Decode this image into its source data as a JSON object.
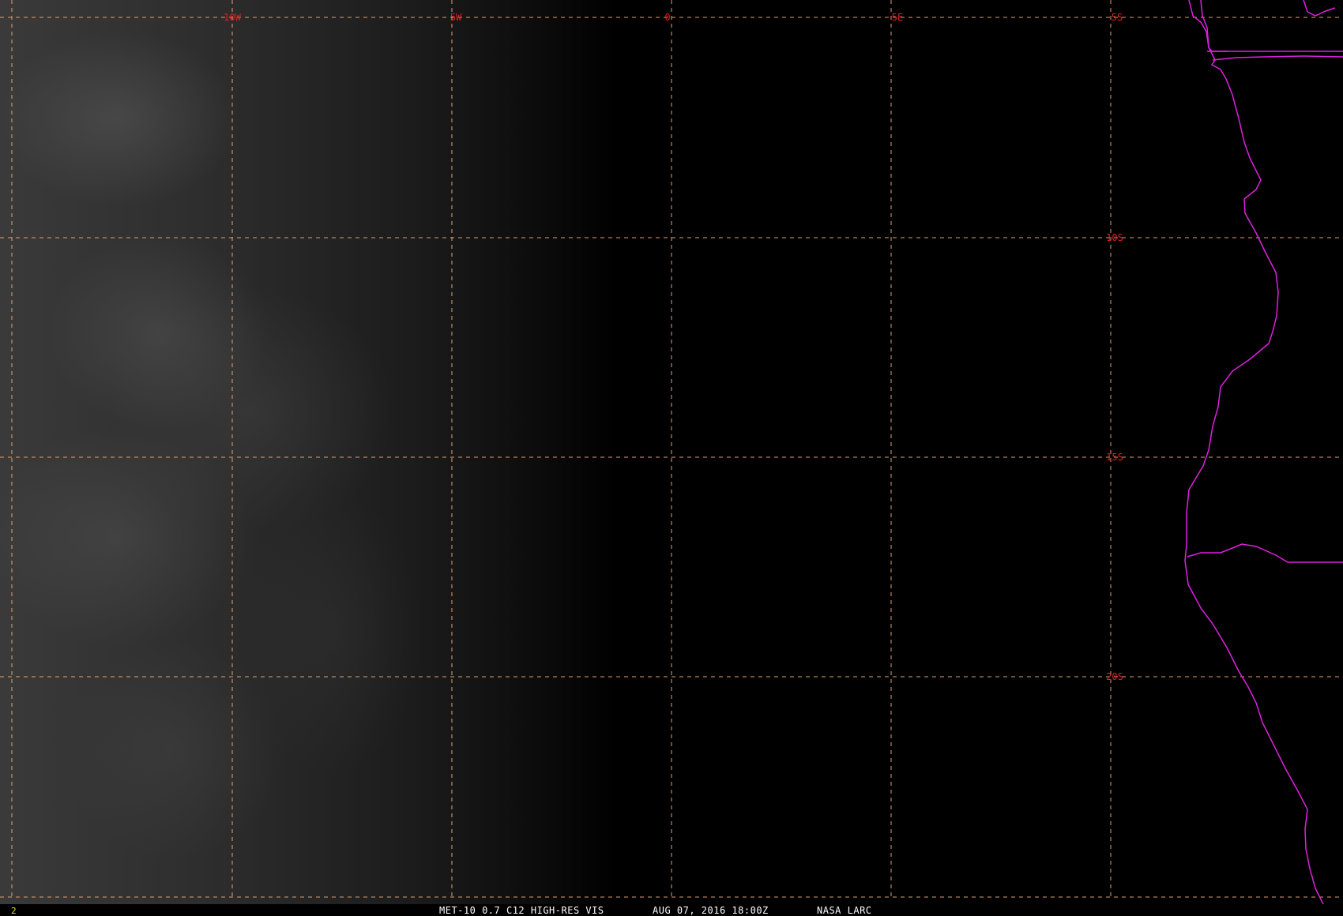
{
  "map": {
    "longitude_labels": [
      "10W",
      "5W",
      "0",
      "5E"
    ],
    "latitude_labels": [
      "5S",
      "10S",
      "15S",
      "20S"
    ],
    "colors": {
      "grid": "#e0a070",
      "grid_labels": "#e02020",
      "coastline": "#e020e0",
      "frame_number": "#e0e020",
      "caption": "#ffffff"
    }
  },
  "status_bar": {
    "frame_number": "2",
    "product": "MET-10 0.7 C12 HIGH-RES VIS",
    "datetime": "AUG 07, 2016 18:00Z",
    "source": "NASA LARC"
  }
}
